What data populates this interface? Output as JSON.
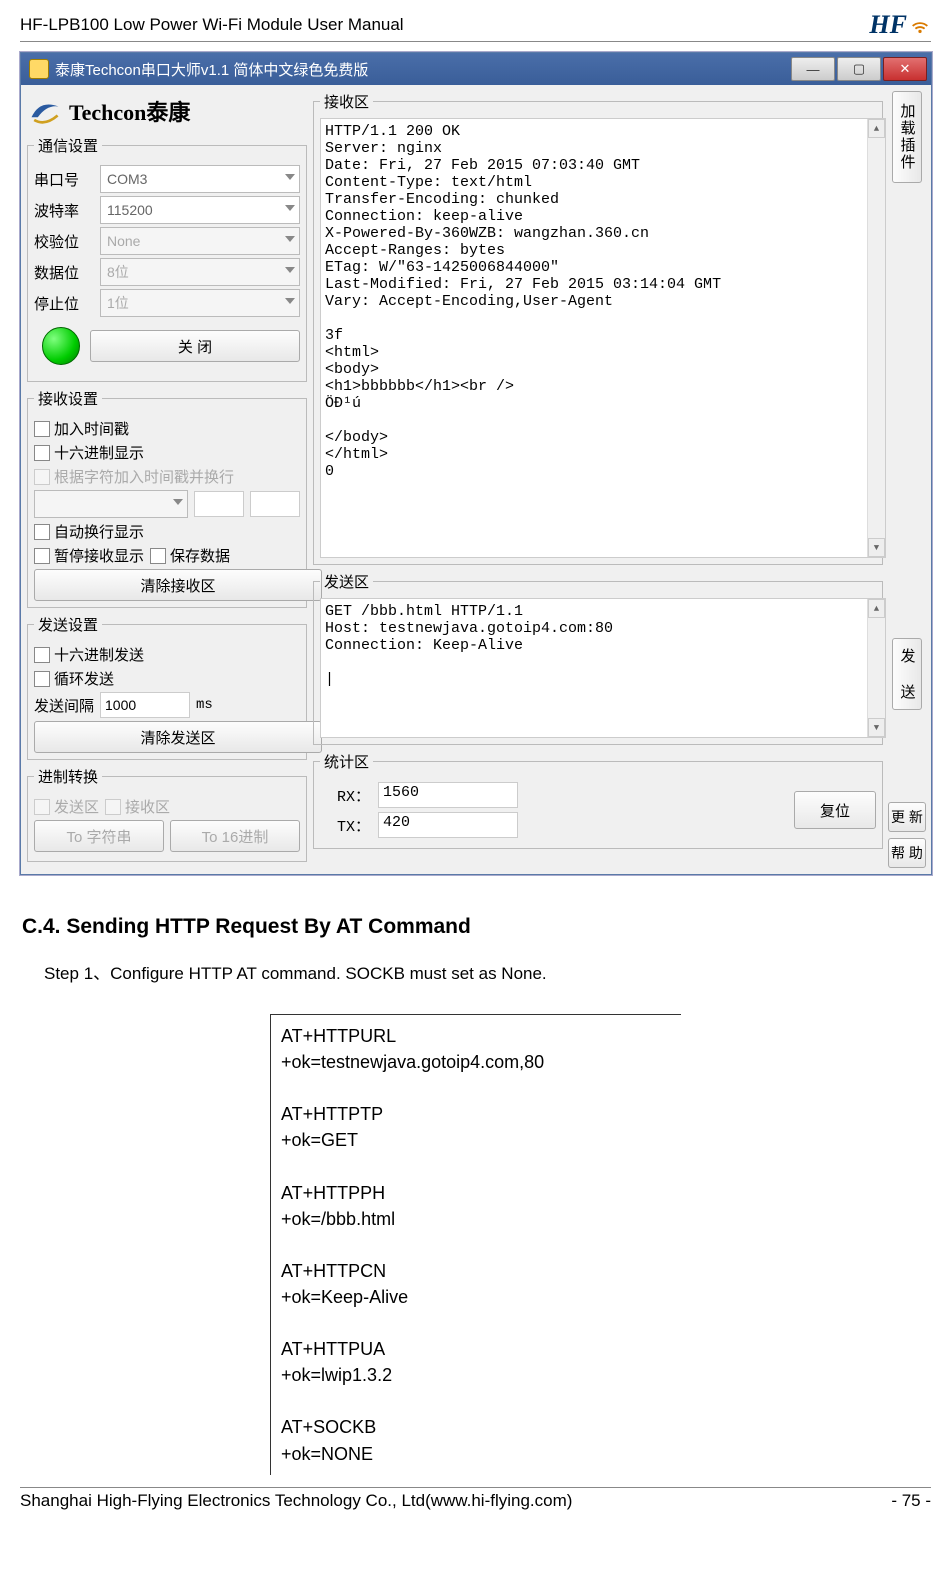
{
  "header": {
    "title": "HF-LPB100 Low Power Wi-Fi Module User Manual",
    "brand": "HF"
  },
  "footer": {
    "left": "Shanghai High-Flying Electronics Technology Co., Ltd(www.hi-flying.com)",
    "right": "- 75 -"
  },
  "window": {
    "title": "泰康Techcon串口大师v1.1 简体中文绿色免费版",
    "logo_text": "Techcon泰康",
    "comm_group": "通信设置",
    "port_label": "串口号",
    "port_value": "COM3",
    "baud_label": "波特率",
    "baud_value": "115200",
    "parity_label": "校验位",
    "parity_value": "None",
    "databits_label": "数据位",
    "databits_value": "8位",
    "stopbits_label": "停止位",
    "stopbits_value": "1位",
    "close_btn": "关    闭",
    "recv_group": "接收设置",
    "chk_timestamp": "加入时间戳",
    "chk_hex_show": "十六进制显示",
    "chk_timestamp_newline": "根据字符加入时间戳并换行",
    "chk_autowrap": "自动换行显示",
    "chk_pause": "暂停接收显示",
    "chk_save": "保存数据",
    "clear_recv": "清除接收区",
    "send_group_left": "发送设置",
    "chk_hex_send": "十六进制发送",
    "chk_loop": "循环发送",
    "interval_label": "发送间隔",
    "interval_value": "1000",
    "interval_unit": "ms",
    "clear_send": "清除发送区",
    "convert_group": "进制转换",
    "chk_conv_send": "发送区",
    "chk_conv_recv": "接收区",
    "to_string": "To 字符串",
    "to_hex": "To 16进制",
    "recv_area": "接收区",
    "send_area": "发送区",
    "stats_area": "统计区",
    "recv_text": "HTTP/1.1 200 OK\nServer: nginx\nDate: Fri, 27 Feb 2015 07:03:40 GMT\nContent-Type: text/html\nTransfer-Encoding: chunked\nConnection: keep-alive\nX-Powered-By-360WZB: wangzhan.360.cn\nAccept-Ranges: bytes\nETag: W/\"63-1425006844000\"\nLast-Modified: Fri, 27 Feb 2015 03:14:04 GMT\nVary: Accept-Encoding,User-Agent\n\n3f\n<html>\n<body>\n<h1>bbbbbb</h1><br />\nÖÐ¹ú\n\n</body>\n</html>\n0",
    "send_text": "GET /bbb.html HTTP/1.1\nHost: testnewjava.gotoip4.com:80\nConnection: Keep-Alive\n\n|",
    "rx_label": "RX：",
    "rx_value": "1560",
    "tx_label": "TX：",
    "tx_value": "420",
    "reset_btn": "复位",
    "right_load": "加载插件",
    "right_send": "发 送",
    "right_update": "更 新",
    "right_help": "帮 助"
  },
  "section": {
    "heading": "C.4. Sending HTTP Request By AT Command",
    "step1": "Step 1、Configure HTTP AT command. SOCKB must set as None.",
    "terminal": "AT+HTTPURL\n+ok=testnewjava.gotoip4.com,80\n\nAT+HTTPTP\n+ok=GET\n\nAT+HTTPPH\n+ok=/bbb.html\n\nAT+HTTPCN\n+ok=Keep-Alive\n\nAT+HTTPUA\n+ok=lwip1.3.2\n\nAT+SOCKB\n+ok=NONE"
  }
}
